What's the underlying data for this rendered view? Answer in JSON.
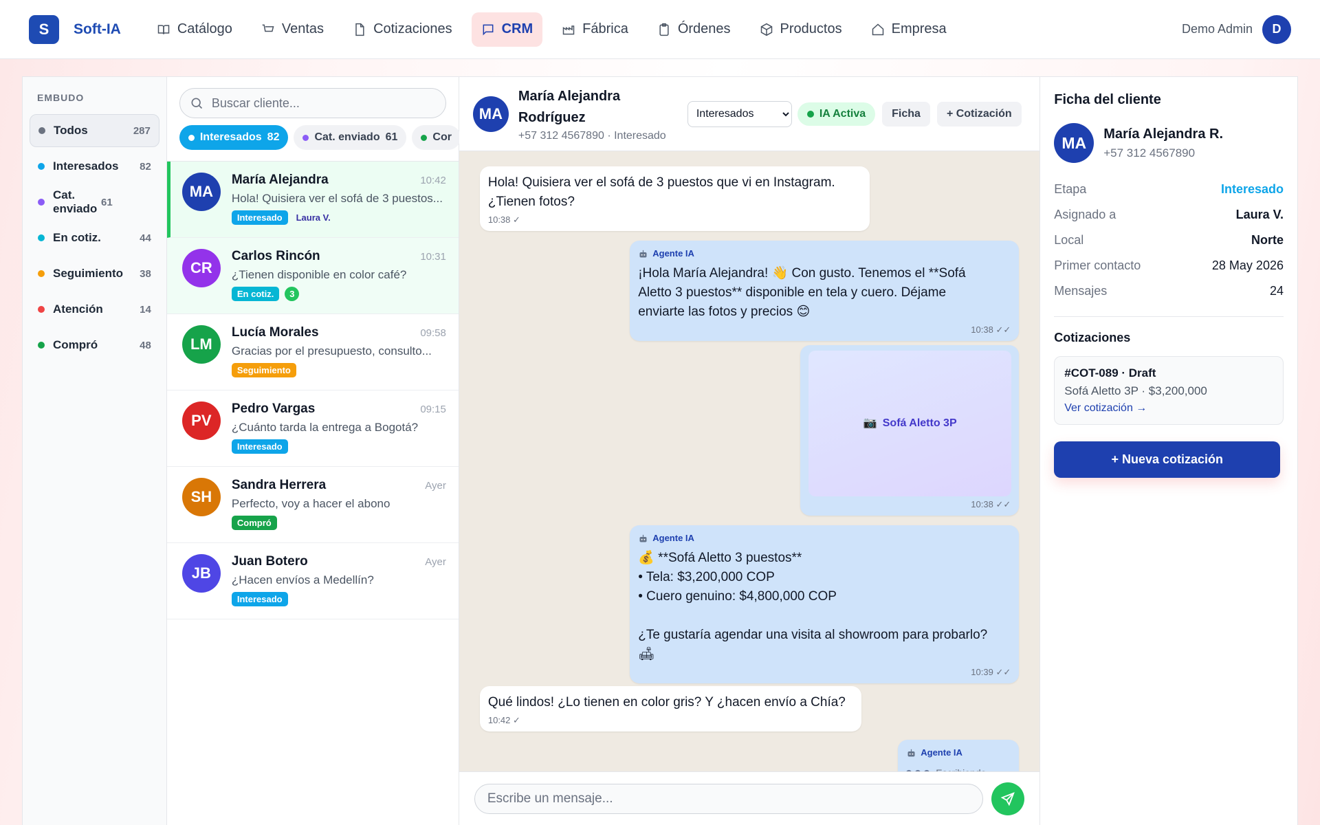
{
  "app": {
    "logo_letter": "S",
    "name": "Soft-IA",
    "accent": "#1e4bb3"
  },
  "nav": [
    {
      "label": "Catálogo",
      "icon": "book-icon"
    },
    {
      "label": "Ventas",
      "icon": "cart-icon"
    },
    {
      "label": "Cotizaciones",
      "icon": "document-icon"
    },
    {
      "label": "CRM",
      "icon": "chat-icon",
      "active": true
    },
    {
      "label": "Fábrica",
      "icon": "factory-icon"
    },
    {
      "label": "Órdenes",
      "icon": "clipboard-icon"
    },
    {
      "label": "Productos",
      "icon": "box-icon"
    },
    {
      "label": "Empresa",
      "icon": "home-icon"
    }
  ],
  "user": {
    "name": "Demo Admin",
    "initial": "D"
  },
  "funnel": {
    "heading": "EMBUDO",
    "items": [
      {
        "label": "Todos",
        "count": "287",
        "color": "#6b7280",
        "active": true
      },
      {
        "label": "Interesados",
        "count": "82",
        "color": "#0ea5e9"
      },
      {
        "label": "Cat. enviado",
        "count": "61",
        "color": "#8b5cf6"
      },
      {
        "label": "En cotiz.",
        "count": "44",
        "color": "#06b6d4"
      },
      {
        "label": "Seguimiento",
        "count": "38",
        "color": "#f59e0b"
      },
      {
        "label": "Atención",
        "count": "14",
        "color": "#ef4444"
      },
      {
        "label": "Compró",
        "count": "48",
        "color": "#16a34a"
      }
    ]
  },
  "search": {
    "placeholder": "Buscar cliente..."
  },
  "chips": [
    {
      "label": "Interesados",
      "count": "82",
      "color": "#0ea5e9",
      "active": true
    },
    {
      "label": "Cat. enviado",
      "count": "61",
      "color": "#8b5cf6"
    },
    {
      "label": "Cor",
      "count": "",
      "color": "#16a34a"
    }
  ],
  "conversations": [
    {
      "initials": "MA",
      "name": "María Alejandra",
      "time": "10:42",
      "preview": "Hola! Quisiera ver el sofá de 3 puestos...",
      "avatar_color": "#1e40af",
      "tags": [
        {
          "label": "Interesado",
          "color": "#0ea5e9"
        },
        {
          "label": "Laura V.",
          "plain": true
        }
      ],
      "active": true
    },
    {
      "initials": "CR",
      "name": "Carlos Rincón",
      "time": "10:31",
      "preview": "¿Tienen disponible en color café?",
      "avatar_color": "#9333ea",
      "tags": [
        {
          "label": "En cotiz.",
          "color": "#06b6d4"
        },
        {
          "label": "3",
          "round": true
        }
      ],
      "mint": true
    },
    {
      "initials": "LM",
      "name": "Lucía Morales",
      "time": "09:58",
      "preview": "Gracias por el presupuesto, consulto...",
      "avatar_color": "#16a34a",
      "tags": [
        {
          "label": "Seguimiento",
          "color": "#f59e0b"
        }
      ]
    },
    {
      "initials": "PV",
      "name": "Pedro Vargas",
      "time": "09:15",
      "preview": "¿Cuánto tarda la entrega a Bogotá?",
      "avatar_color": "#dc2626",
      "tags": [
        {
          "label": "Interesado",
          "color": "#0ea5e9"
        }
      ]
    },
    {
      "initials": "SH",
      "name": "Sandra Herrera",
      "time": "Ayer",
      "preview": "Perfecto, voy a hacer el abono",
      "avatar_color": "#d97706",
      "tags": [
        {
          "label": "Compró",
          "color": "#16a34a"
        }
      ]
    },
    {
      "initials": "JB",
      "name": "Juan Botero",
      "time": "Ayer",
      "preview": "¿Hacen envíos a Medellín?",
      "avatar_color": "#4f46e5",
      "tags": [
        {
          "label": "Interesado",
          "color": "#0ea5e9"
        }
      ]
    }
  ],
  "chat": {
    "header": {
      "initials": "MA",
      "name_line1": "María Alejandra",
      "name_line2": "Rodríguez",
      "subtitle": "+57 312 4567890 · Interesado",
      "stage_select": "Interesados",
      "ia_badge": "IA Activa",
      "ficha_button": "Ficha",
      "quote_button": "+ Cotización"
    },
    "agent_label": "Agente IA",
    "messages": [
      {
        "dir": "in",
        "lines": [
          "Hola! Quisiera ver el sofá de 3 puestos que vi en Instagram.",
          "¿Tienen fotos?"
        ],
        "time": "10:38 ✓"
      },
      {
        "dir": "out",
        "agent": true,
        "lines": [
          "¡Hola María Alejandra! 👋 Con gusto. Tenemos el **Sofá",
          "Aletto 3 puestos** disponible en tela y cuero. Déjame",
          "enviarte las fotos y precios 😊"
        ],
        "time": "10:38 ✓✓"
      },
      {
        "dir": "out",
        "image": true,
        "image_label": "Sofá Aletto 3P",
        "image_icon": "📷",
        "time": "10:38 ✓✓"
      },
      {
        "dir": "out",
        "agent": true,
        "lines": [
          "💰 **Sofá Aletto 3 puestos**",
          "• Tela: $3,200,000 COP",
          "• Cuero genuino: $4,800,000 COP",
          "",
          "¿Te gustaría agendar una visita al showroom para probarlo?",
          "🛋"
        ],
        "time": "10:39 ✓✓"
      },
      {
        "dir": "in",
        "lines": [
          "Qué lindos! ¿Lo tienen en color gris? Y ¿hacen envío a Chía?"
        ],
        "time": "10:42 ✓"
      },
      {
        "dir": "out",
        "agent": true,
        "typing": "Escribiendo..."
      }
    ],
    "composer_placeholder": "Escribe un mensaje..."
  },
  "client": {
    "title": "Ficha del cliente",
    "initials": "MA",
    "name": "María Alejandra R.",
    "phone": "+57 312 4567890",
    "fields": [
      {
        "key": "Etapa",
        "value": "Interesado",
        "style": "stage"
      },
      {
        "key": "Asignado a",
        "value": "Laura V."
      },
      {
        "key": "Local",
        "value": "Norte"
      },
      {
        "key": "Primer contacto",
        "value": "28 May 2026",
        "style": "num"
      },
      {
        "key": "Mensajes",
        "value": "24",
        "style": "num"
      }
    ],
    "quotes_title": "Cotizaciones",
    "quote": {
      "id": "#COT-089 · Draft",
      "desc": "Sofá Aletto 3P · $3,200,000",
      "link": "Ver cotización →"
    },
    "new_quote_button": "+ Nueva cotización"
  }
}
